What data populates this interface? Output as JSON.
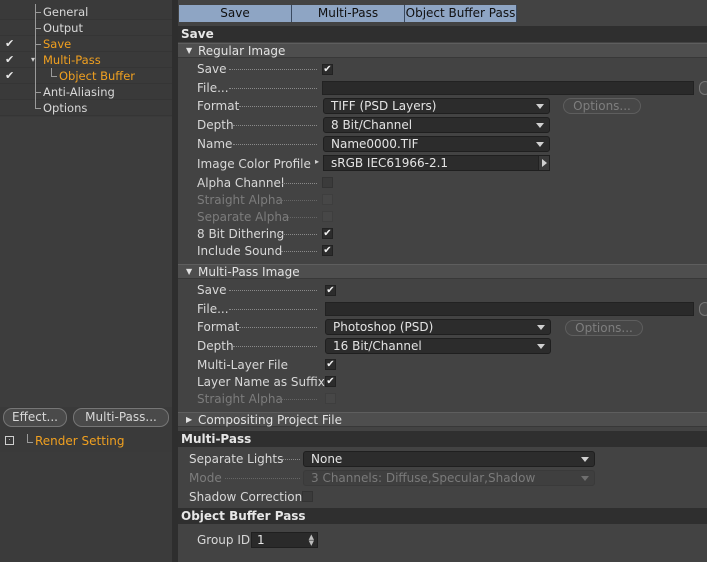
{
  "tree": {
    "items": [
      {
        "label": "General",
        "checked": false,
        "orange": false
      },
      {
        "label": "Output",
        "checked": false,
        "orange": false
      },
      {
        "label": "Save",
        "checked": true,
        "orange": true
      },
      {
        "label": "Multi-Pass",
        "checked": true,
        "orange": true
      },
      {
        "label": "Object Buffer",
        "checked": true,
        "orange": true
      },
      {
        "label": "Anti-Aliasing",
        "checked": false,
        "orange": false
      },
      {
        "label": "Options",
        "checked": false,
        "orange": false
      }
    ],
    "check_glyph": "✔",
    "effect_button": "Effect...",
    "multipass_button": "Multi-Pass...",
    "render_setting": "Render Setting"
  },
  "tabs": [
    "Save",
    "Multi-Pass",
    "Object Buffer Pass"
  ],
  "save_section": {
    "title": "Save",
    "regular_image": {
      "group_label": "Regular Image",
      "save_label": "Save",
      "file_label": "File...",
      "format_label": "Format",
      "format_value": "TIFF (PSD Layers)",
      "options_button": "Options...",
      "depth_label": "Depth",
      "depth_value": "8 Bit/Channel",
      "name_label": "Name",
      "name_value": "Name0000.TIF",
      "profile_label": "Image Color Profile",
      "profile_value": "sRGB IEC61966-2.1",
      "alpha_label": "Alpha Channel",
      "straight_alpha_label": "Straight Alpha",
      "separate_alpha_label": "Separate Alpha",
      "dithering_label": "8 Bit Dithering",
      "include_sound_label": "Include Sound"
    },
    "multipass_image": {
      "group_label": "Multi-Pass Image",
      "save_label": "Save",
      "file_label": "File...",
      "format_label": "Format",
      "format_value": "Photoshop (PSD)",
      "options_button": "Options...",
      "depth_label": "Depth",
      "depth_value": "16 Bit/Channel",
      "multilayer_label": "Multi-Layer File",
      "layername_label": "Layer Name as Suffix",
      "straight_alpha_label": "Straight Alpha"
    },
    "compositing_label": "Compositing Project File"
  },
  "multipass_section": {
    "title": "Multi-Pass",
    "separate_lights_label": "Separate Lights",
    "separate_lights_value": "None",
    "mode_label": "Mode",
    "mode_value": "3 Channels: Diffuse,Specular,Shadow",
    "shadow_correction_label": "Shadow Correction"
  },
  "objectbuffer_section": {
    "title": "Object Buffer Pass",
    "group_id_label": "Group ID",
    "group_id_value": "1"
  },
  "colors": {
    "accent_orange": "#f0a020",
    "tab_blue": "#8ea5c4",
    "panel_bg": "#434343"
  }
}
